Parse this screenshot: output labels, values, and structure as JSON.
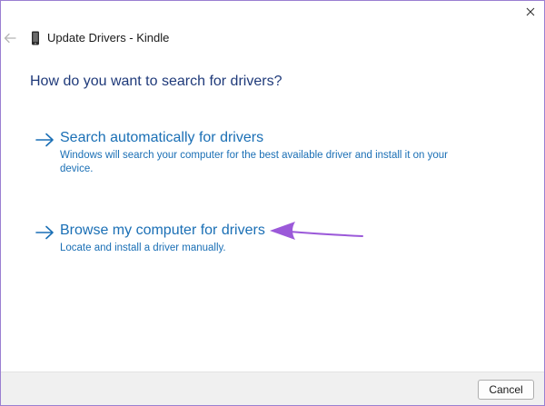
{
  "window": {
    "title": "Update Drivers - Kindle",
    "close_icon": "close-icon",
    "back_icon": "back-arrow-icon",
    "device_icon": "phone-device-icon"
  },
  "main": {
    "question": "How do you want to search for drivers?",
    "options": [
      {
        "title": "Search automatically for drivers",
        "description": "Windows will search your computer for the best available driver and install it on your device.",
        "icon": "arrow-right-icon"
      },
      {
        "title": "Browse my computer for drivers",
        "description": "Locate and install a driver manually.",
        "icon": "arrow-right-icon"
      }
    ]
  },
  "annotation": {
    "icon": "pointer-arrow-icon",
    "color": "#9b59d9"
  },
  "footer": {
    "cancel_label": "Cancel"
  },
  "colors": {
    "link": "#1a6fb5",
    "heading": "#1f3a7a",
    "border": "#9a7fd1",
    "footer_bg": "#f0f0f0"
  }
}
